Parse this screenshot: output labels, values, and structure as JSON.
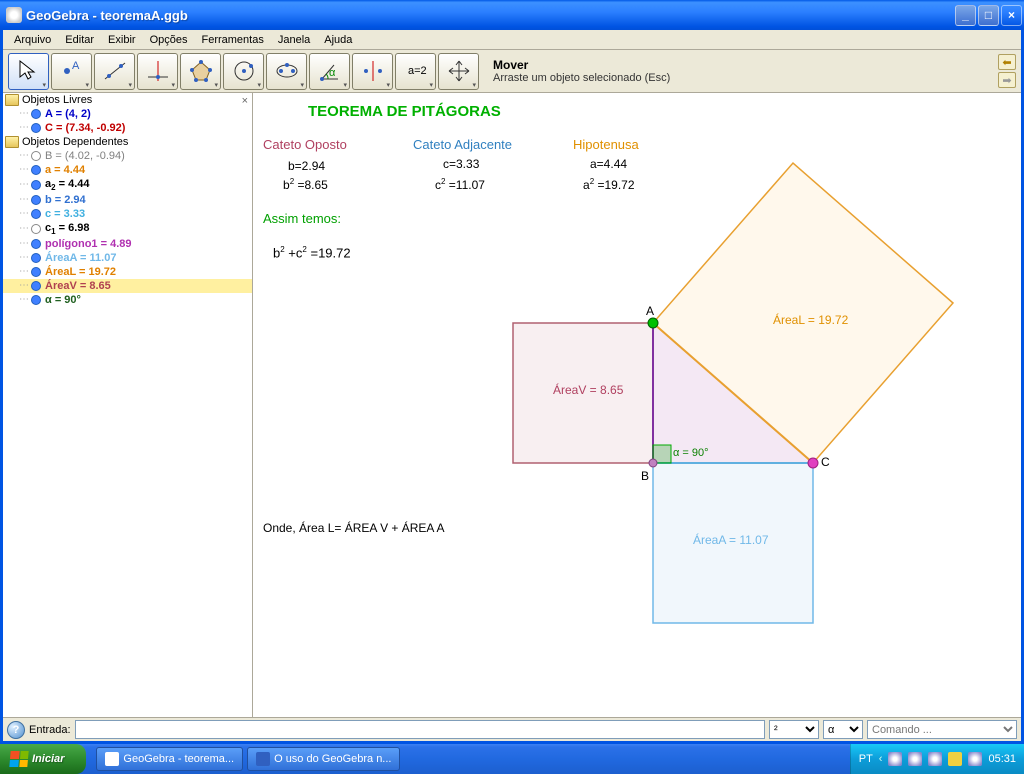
{
  "window": {
    "title": "GeoGebra - teoremaA.ggb"
  },
  "menu": [
    "Arquivo",
    "Editar",
    "Exibir",
    "Opções",
    "Ferramentas",
    "Janela",
    "Ajuda"
  ],
  "tool_hint": {
    "title": "Mover",
    "desc": "Arraste um objeto selecionado (Esc)"
  },
  "sidebar": {
    "free_label": "Objetos Livres",
    "free": [
      {
        "html": "A = (4, 2)",
        "color": "#0000c8",
        "bold": true,
        "dot": "blue"
      },
      {
        "html": "C = (7.34, -0.92)",
        "color": "#c00000",
        "bold": true,
        "dot": "blue"
      }
    ],
    "dep_label": "Objetos Dependentes",
    "dep": [
      {
        "html": "B = (4.02, -0.94)",
        "color": "#808080",
        "dot": "hollow"
      },
      {
        "html": "a = 4.44",
        "color": "#e08000",
        "bold": true,
        "dot": "blue"
      },
      {
        "html": "a<sub>2</sub> = 4.44",
        "color": "#000000",
        "bold": true,
        "dot": "blue"
      },
      {
        "html": "b = 2.94",
        "color": "#3070d0",
        "bold": true,
        "dot": "blue"
      },
      {
        "html": "c = 3.33",
        "color": "#40b0e0",
        "bold": true,
        "dot": "blue"
      },
      {
        "html": "c<sub>1</sub> = 6.98",
        "color": "#000000",
        "bold": true,
        "dot": "hollow"
      },
      {
        "html": "polígono1 = 4.89",
        "color": "#b030b0",
        "bold": true,
        "dot": "blue"
      },
      {
        "html": "ÁreaA = 11.07",
        "color": "#70b8e8",
        "bold": true,
        "dot": "blue"
      },
      {
        "html": "ÁreaL = 19.72",
        "color": "#e08000",
        "bold": true,
        "dot": "blue"
      },
      {
        "html": "ÁreaV = 8.65",
        "color": "#b04050",
        "bold": true,
        "dot": "blue",
        "hl": true
      },
      {
        "html": "α = 90°",
        "color": "#206020",
        "bold": true,
        "dot": "blue"
      }
    ]
  },
  "body_text": {
    "title": "TEOREMA DE PITÁGORAS",
    "col1_h": "Cateto Oposto",
    "col1_l1": "b=2.94",
    "col1_l2": "b² =8.65",
    "col2_h": "Cateto Adjacente",
    "col2_l1": "c=3.33",
    "col2_l2": "c² =11.07",
    "col3_h": "Hipotenusa",
    "col3_l1": "a=4.44",
    "col3_l2": "a² =19.72",
    "assim": "Assim temos:",
    "eq": "b² +c² =19.72",
    "onde": "Onde, Área L= ÁREA V + ÁREA A",
    "areaV": "ÁreaV = 8.65",
    "areaA": "ÁreaA = 11.07",
    "areaL": "ÁreaL = 19.72",
    "alpha": "α = 90°",
    "A": "A",
    "B": "B",
    "C": "C"
  },
  "inputbar": {
    "label": "Entrada:",
    "sel1": "²",
    "sel2": "α",
    "cmd": "Comando ..."
  },
  "taskbar": {
    "start": "Iniciar",
    "tasks": [
      "GeoGebra - teorema...",
      "O uso do GeoGebra n..."
    ],
    "lang": "PT",
    "clock": "05:31"
  },
  "chart_data": {
    "type": "diagram",
    "description": "Pythagorean theorem: right triangle ABC with squares on each side",
    "points": {
      "A": [
        4,
        2
      ],
      "B": [
        4.02,
        -0.94
      ],
      "C": [
        7.34,
        -0.92
      ]
    },
    "sides": {
      "a_hypotenuse": 4.44,
      "b_opposite": 2.94,
      "c_adjacent": 3.33
    },
    "squares": {
      "AreaV_on_b": 8.65,
      "AreaA_on_c": 11.07,
      "AreaL_on_a": 19.72
    },
    "angle_alpha_deg": 90,
    "identity": "b^2 + c^2 = a^2 = 19.72"
  }
}
